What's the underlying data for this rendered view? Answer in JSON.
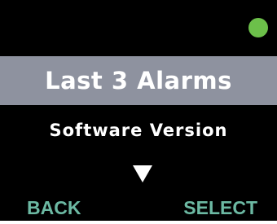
{
  "status": {
    "indicator_color": "#6cc04a",
    "icon": "status-led"
  },
  "menu": {
    "items": [
      {
        "label": "Last 3 Alarms",
        "selected": true
      },
      {
        "label": "Software Version",
        "selected": false
      }
    ],
    "highlight_color": "#8e929f",
    "scroll_indicator": "down-arrow"
  },
  "softkeys": {
    "back_label": "BACK",
    "select_label": "SELECT",
    "color": "#6cb9a3"
  },
  "colors": {
    "background": "#000000",
    "text": "#ffffff"
  }
}
